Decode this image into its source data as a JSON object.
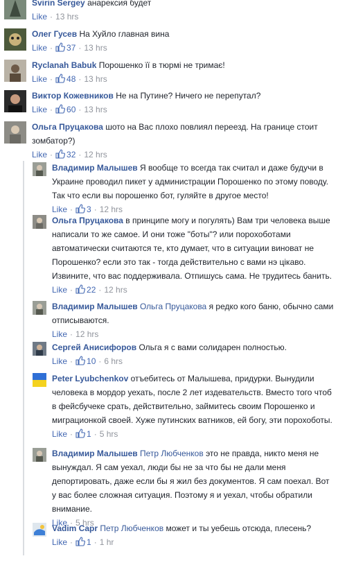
{
  "comments": [
    {
      "name": "Svirin Sergey",
      "mention": "",
      "text": "анарексия будет",
      "like": "Like",
      "likes": "",
      "time": "13 hrs"
    },
    {
      "name": "Олег Гусев",
      "mention": "",
      "text": "На Хуйло главная вина",
      "like": "Like",
      "likes": "37",
      "time": "13 hrs"
    },
    {
      "name": "Ryclanah Babuk",
      "mention": "",
      "text": "Порошенко її в тюрмі не тримає!",
      "like": "Like",
      "likes": "48",
      "time": "13 hrs"
    },
    {
      "name": "Виктор Кожевников",
      "mention": "",
      "text": "Не на Путине? Ничего не перепутал?",
      "like": "Like",
      "likes": "60",
      "time": "13 hrs"
    },
    {
      "name": "Ольга Пруцакова",
      "mention": "",
      "text": "шото на Вас плохо повлиял переезд. На границе стоит зомбатор?)",
      "like": "Like",
      "likes": "32",
      "time": "12 hrs"
    }
  ],
  "replies": [
    {
      "name": "Владимир Малышев",
      "mention": "",
      "text": "Я вообще то всегда так считал и даже будучи в Украине проводил пикет у администрации Порошенко по этому поводу. Так что если вы порошенко бот, гуляйте в другое место!",
      "like": "Like",
      "likes": "3",
      "time": "12 hrs"
    },
    {
      "name": "Ольга Пруцакова",
      "mention": "",
      "text": "в принципе могу и погулять) Вам три человека выше написали то же самое. И они тоже \"боты\"? или порохоботами автоматически считаются те, кто думает, что в ситуации виноват не Порошенко? если это так - тогда действительно с вами нэ цікаво. Извините, что вас поддерживала. Отпишусь сама. Не трудитесь банить.",
      "like": "Like",
      "likes": "22",
      "time": "12 hrs"
    },
    {
      "name": "Владимир Малышев",
      "mention": "Ольга Пруцакова",
      "text": "я редко кого баню, обычно сами отписываются.",
      "like": "Like",
      "likes": "",
      "time": "12 hrs"
    },
    {
      "name": "Сергей Анисифоров",
      "mention": "",
      "text": "Ольга я с вами солидарен полностью.",
      "like": "Like",
      "likes": "10",
      "time": "6 hrs"
    },
    {
      "name": "Peter Lyubchenkov",
      "mention": "",
      "text": "отъебитесь от Малышева, придурки. Вынудили человека в мордор уехать, после 2 лет издевательств. Вместо того чтоб в фейсбучеке срать, действительно, займитесь своим Порошенко и миграционкой своей. Хуже путинских ватников, ей богу, эти порохоботы.",
      "like": "Like",
      "likes": "1",
      "time": "5 hrs"
    },
    {
      "name": "Владимир Малышев",
      "mention": "Петр Любченков",
      "text": "это не правда, никто меня не вынуждал. Я сам уехал, люди бы не за что бы не дали меня депортировать, даже если бы я жил без документов. Я сам поехал. Вот у вас более сложная ситуация. Поэтому я и уехал, чтобы обратили внимание.",
      "like": "Like",
      "likes": "",
      "time": "5 hrs"
    },
    {
      "name": "Vadim Capr",
      "mention": "Петр Любченков",
      "text": "может и ты уебешь отсюда, плесень?",
      "like": "Like",
      "likes": "1",
      "time": "1 hr"
    }
  ],
  "colors": {
    "link": "#365899",
    "like": "#4267b2",
    "meta": "#90949c",
    "text": "#1d2129"
  },
  "icons": {
    "thumb": "thumbs-up-icon"
  }
}
